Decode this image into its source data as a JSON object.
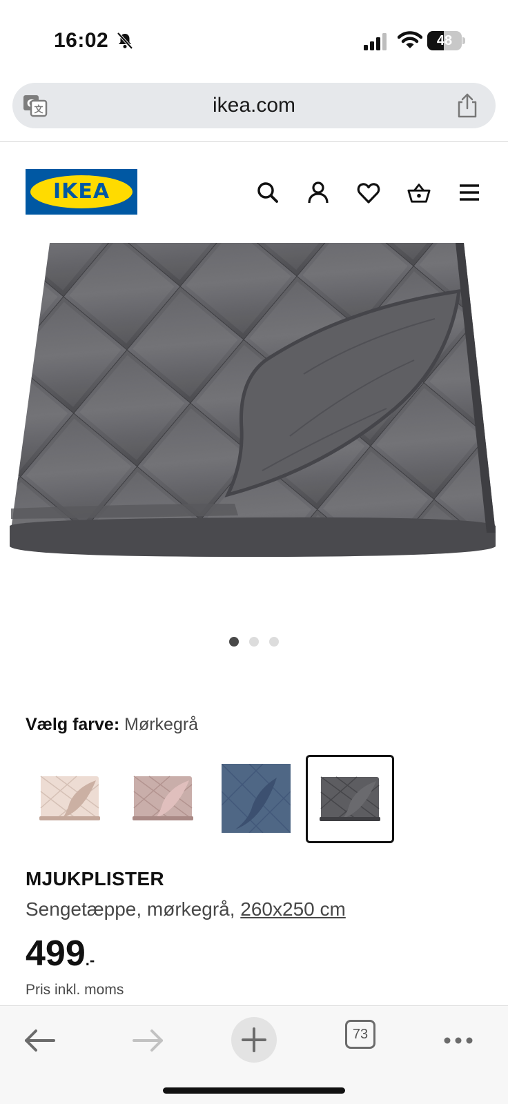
{
  "status_bar": {
    "time": "16:02",
    "battery_level": "48",
    "battery_fraction": 0.48,
    "icons": [
      "bell-slash-icon",
      "cellular-signal-icon",
      "wifi-icon",
      "battery-icon"
    ]
  },
  "browser": {
    "url": "ikea.com",
    "icons": [
      "translate-icon",
      "share-icon"
    ]
  },
  "site_header": {
    "logo_text": "IKEA",
    "icons": [
      "search-icon",
      "account-icon",
      "heart-icon",
      "basket-icon",
      "menu-icon"
    ],
    "colors": {
      "brand_blue": "#0058a3",
      "brand_yellow": "#ffdb00"
    }
  },
  "gallery": {
    "image_count": 3,
    "active_index": 0
  },
  "color_picker": {
    "label": "Vælg farve:",
    "selected_value": "Mørkegrå",
    "swatches": [
      {
        "color": "#e8d4cb",
        "selected": false
      },
      {
        "color": "#c9aaa6",
        "selected": false
      },
      {
        "color": "#4f6785",
        "selected": true,
        "_": "placeholder"
      },
      {
        "color": "#5a5a5e",
        "selected": true
      }
    ]
  },
  "product": {
    "name": "MJUKPLISTER",
    "description_prefix": "Sengetæppe, mørkegrå, ",
    "size_link": "260x250 cm",
    "price_main": "499",
    "price_suffix": ".-",
    "vat_note": "Pris inkl. moms"
  },
  "toolbar": {
    "tab_count": "73",
    "icons": [
      "back-arrow-icon",
      "forward-arrow-icon",
      "plus-icon",
      "tabs-icon",
      "more-icon"
    ]
  }
}
